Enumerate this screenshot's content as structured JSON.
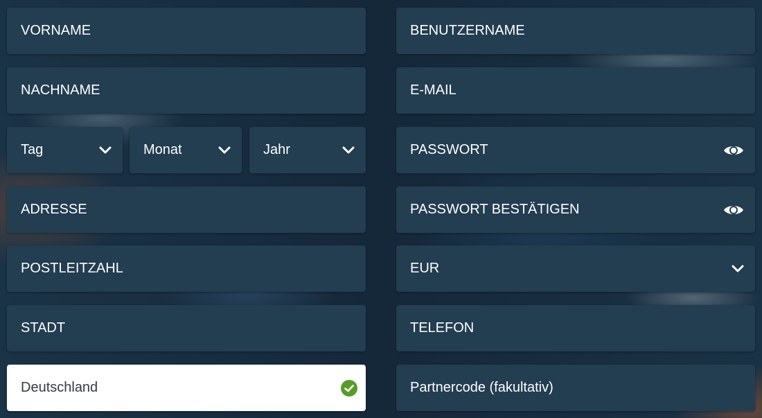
{
  "form": {
    "left": {
      "vorname": "VORNAME",
      "nachname": "NACHNAME",
      "day_placeholder": "Tag",
      "month_placeholder": "Monat",
      "year_placeholder": "Jahr",
      "adresse": "ADRESSE",
      "postleitzahl": "POSTLEITZAHL",
      "stadt": "STADT",
      "country_value": "Deutschland"
    },
    "right": {
      "benutzername": "BENUTZERNAME",
      "email": "E-MAIL",
      "passwort": "PASSWORT",
      "passwort_bestaetigen": "PASSWORT BESTÄTIGEN",
      "currency_value": "EUR",
      "telefon": "TELEFON",
      "partnercode": "Partnercode (fakultativ)"
    }
  },
  "icons": {
    "chevron": "chevron-down-icon",
    "eye": "eye-icon",
    "check": "check-circle-icon"
  },
  "colors": {
    "field_bg": "#233d51",
    "page_bg": "#15283a",
    "text": "#ffffff",
    "valid_green": "#5a9a2a"
  }
}
